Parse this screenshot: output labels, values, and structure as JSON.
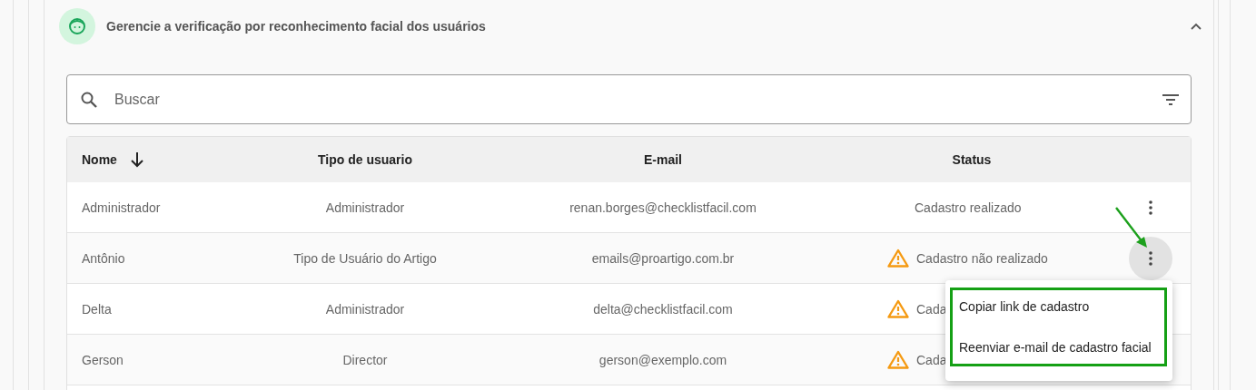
{
  "panel": {
    "title": "Gerencie a verificação por reconhecimento facial dos usuários",
    "expanded": true
  },
  "search": {
    "placeholder": "Buscar"
  },
  "table": {
    "columns": [
      {
        "label": "Nome",
        "sorted": true
      },
      {
        "label": "Tipo de usuario",
        "sorted": false
      },
      {
        "label": "E-mail",
        "sorted": false
      },
      {
        "label": "Status",
        "sorted": false
      }
    ],
    "rows": [
      {
        "name": "Administrador",
        "type": "Administrador",
        "email": "renan.borges@checklistfacil.com",
        "status": "Cadastro realizado",
        "warning": false,
        "menu_open": false
      },
      {
        "name": "Antônio",
        "type": "Tipo de Usuário do Artigo",
        "email": "emails@proartigo.com.br",
        "status": "Cadastro não realizado",
        "warning": true,
        "menu_open": true
      },
      {
        "name": "Delta",
        "type": "Administrador",
        "email": "delta@checklistfacil.com",
        "status": "Cada",
        "warning": true,
        "menu_open": false
      },
      {
        "name": "Gerson",
        "type": "Director",
        "email": "gerson@exemplo.com",
        "status": "Cada",
        "warning": true,
        "menu_open": false
      }
    ]
  },
  "menu": {
    "items": [
      "Copiar link de cadastro",
      "Reenviar e-mail de cadastro facial"
    ]
  }
}
